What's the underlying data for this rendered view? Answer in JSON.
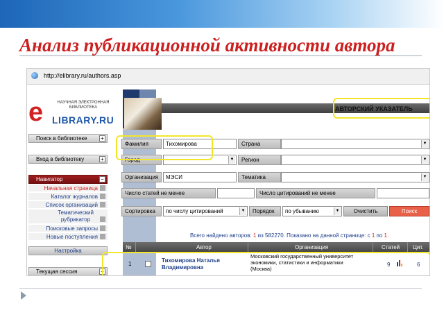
{
  "slide": {
    "title": "Анализ публикационной активности автора"
  },
  "browser": {
    "url": "http://elibrary.ru/authors.asp"
  },
  "logo": {
    "tagline": "НАУЧНАЯ ЭЛЕКТРОННАЯ БИБЛИОТЕКА",
    "name": "LIBRARY.RU",
    "letter": "e"
  },
  "left_panel": {
    "search_library": "Поиск в библиотеке",
    "login_library": "Вход в библиотеку",
    "navigator": "Навигатор",
    "nav_items": [
      {
        "label": "Начальная страница"
      },
      {
        "label": "Каталог журналов"
      },
      {
        "label": "Список организаций"
      },
      {
        "label": "Тематический рубрикатор"
      },
      {
        "label": "Поисковые запросы"
      },
      {
        "label": "Новые поступления"
      }
    ],
    "settings": "Настройка",
    "current_session": "Текущая сессия"
  },
  "header": {
    "author_index": "АВТОРСКИЙ УКАЗАТЕЛЬ"
  },
  "form": {
    "surname_label": "Фамилия",
    "surname_value": "Тихомирова",
    "country_label": "Страна",
    "country_value": "",
    "city_label": "Город",
    "city_value": "",
    "region_label": "Регион",
    "region_value": "",
    "org_label": "Организация",
    "org_value": "МЭСИ",
    "topic_label": "Тематика",
    "topic_value": "",
    "min_articles_label": "Число статей не менее",
    "min_articles_value": "",
    "min_citations_label": "Число цитирований не менее",
    "min_citations_value": "",
    "sort_label": "Сортировка",
    "sort_value": "по числу цитирований",
    "order_label": "Порядок",
    "order_value": "по убыванию",
    "clear_button": "Очистить",
    "search_button": "Поиск"
  },
  "summary": {
    "found_prefix": "Всего найдено авторов:",
    "found_count": "1",
    "of": "из",
    "total": "582270.",
    "shown_prefix": "Показано на данной странице: с",
    "from": "1",
    "to_word": "по",
    "to": "1."
  },
  "table": {
    "headers": [
      "№",
      "Автор",
      "Организация",
      "Статей",
      "Цит."
    ],
    "rows": [
      {
        "num": "1",
        "author_line1": "Тихомирова Наталья",
        "author_line2": "Владимировна",
        "org_line1": "Московский государственный университет",
        "org_line2": "экономики, статистики и информатики",
        "org_line3": "(Москва)",
        "articles": "9",
        "citations": "6"
      }
    ]
  },
  "colors": {
    "title_red": "#cc1f1f",
    "highlight_yellow": "#f2e62a",
    "link_blue": "#1e3f8a",
    "search_button": "#e96048"
  }
}
